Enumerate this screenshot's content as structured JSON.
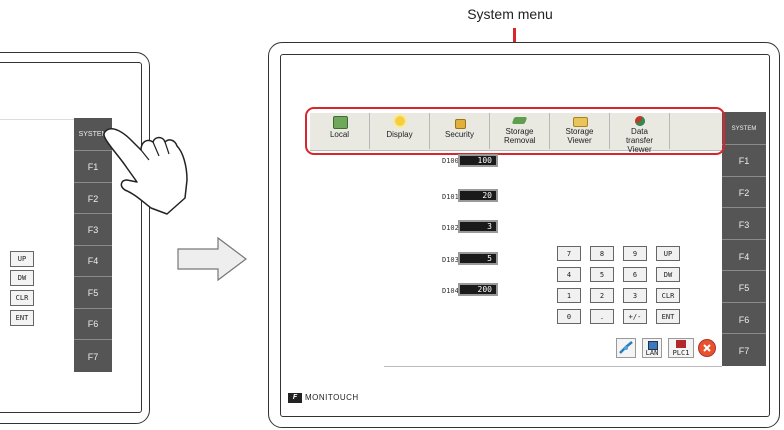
{
  "callout": {
    "label": "System menu"
  },
  "left_panel": {
    "function_keys": [
      "SYSTEM",
      "F1",
      "F2",
      "F3",
      "F4",
      "F5",
      "F6",
      "F7"
    ],
    "side_keys": [
      "UP",
      "DW",
      "CLR",
      "ENT"
    ]
  },
  "right_panel": {
    "function_keys": [
      "SYSTEM",
      "F1",
      "F2",
      "F3",
      "F4",
      "F5",
      "F6",
      "F7"
    ],
    "system_menu": [
      {
        "label": "Local",
        "icon": "local-icon"
      },
      {
        "label": "Display",
        "icon": "sun-icon"
      },
      {
        "label": "Security",
        "icon": "lock-icon"
      },
      {
        "label": "Storage Removal",
        "icon": "storage-removal-icon"
      },
      {
        "label": "Storage Viewer",
        "icon": "folder-icon"
      },
      {
        "label": "Data transfer Viewer",
        "icon": "data-transfer-icon"
      }
    ],
    "data_rows": [
      {
        "label": "D100",
        "value": "100"
      },
      {
        "label": "D101",
        "value": "20"
      },
      {
        "label": "D102",
        "value": "3"
      },
      {
        "label": "D103",
        "value": "5"
      },
      {
        "label": "D104",
        "value": "200"
      }
    ],
    "keypad": [
      [
        "7",
        "8",
        "9",
        "UP"
      ],
      [
        "4",
        "5",
        "6",
        "DW"
      ],
      [
        "1",
        "2",
        "3",
        "CLR"
      ],
      [
        "0",
        ".",
        "+/-",
        "ENT"
      ]
    ],
    "status": {
      "lan": "LAN",
      "plc": "PLC1"
    },
    "brand": "MONITOUCH",
    "brand_logo": "F"
  },
  "colors": {
    "highlight": "#d8262c",
    "fkey_bg": "#555555"
  }
}
